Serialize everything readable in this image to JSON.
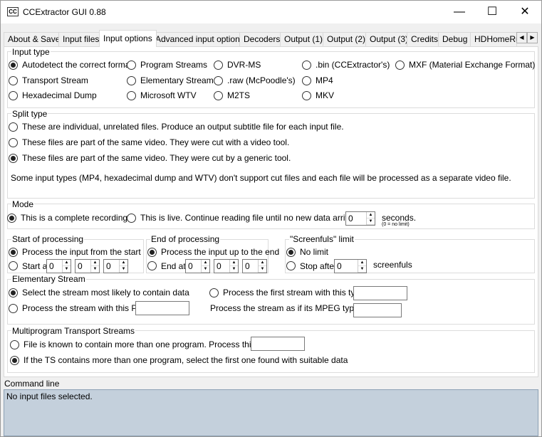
{
  "window": {
    "title": "CCExtractor GUI 0.88",
    "icon_text": "CC"
  },
  "tabs": [
    "About & Save",
    "Input files",
    "Input options",
    "Advanced input options",
    "Decoders",
    "Output (1)",
    "Output (2)",
    "Output (3)",
    "Credits",
    "Debug",
    "HDHomeRu"
  ],
  "input_type": {
    "legend": "Input type",
    "options": [
      "Autodetect the correct format",
      "Program Streams",
      "DVR-MS",
      ".bin (CCExtractor's)",
      "MXF (Material Exchange Format)",
      "Transport Stream",
      "Elementary Stream",
      ".raw (McPoodle's)",
      "MP4",
      "Hexadecimal Dump",
      "Microsoft WTV",
      "M2TS",
      "MKV"
    ]
  },
  "split_type": {
    "legend": "Split type",
    "options": [
      "These are individual, unrelated files. Produce an output subtitle file for each input file.",
      "These files are part of the same video. They were cut with a video tool.",
      "These files are part of the same video. They were cut by a generic tool."
    ],
    "note": "Some input types (MP4, hexadecimal dump and WTV) don't support cut files and each file will be processed as a separate video file."
  },
  "mode": {
    "legend": "Mode",
    "complete": "This is a complete recording",
    "live": "This is live. Continue reading file until no new data arrives for",
    "live_value": "0",
    "seconds": "seconds.",
    "hint": "(0 = no limit)"
  },
  "start": {
    "legend": "Start of processing",
    "from_start": "Process the input from the start",
    "start_at": "Start at",
    "h": "0",
    "m": "0",
    "s": "0"
  },
  "end": {
    "legend": "End of processing",
    "up_to_end": "Process the input up to the end",
    "end_at": "End at",
    "h": "0",
    "m": "0",
    "s": "0"
  },
  "screenfuls": {
    "legend": "\"Screenfuls\" limit",
    "no_limit": "No limit",
    "stop_after": "Stop after",
    "value": "0",
    "unit": "screenfuls"
  },
  "elementary": {
    "legend": "Elementary Stream",
    "likely": "Select the stream most likely to contain data",
    "first_type": "Process the first stream with this type",
    "pid": "Process the stream with this PID",
    "mpeg_as": "Process the stream as if its MPEG type is"
  },
  "multiprogram": {
    "legend": "Multiprogram Transport Streams",
    "known": "File is known to contain more than one program. Process this one:",
    "first_found": "If the TS contains more than one program, select the first one found with suitable data"
  },
  "command_line": {
    "label": "Command line",
    "text": "No input files selected."
  }
}
